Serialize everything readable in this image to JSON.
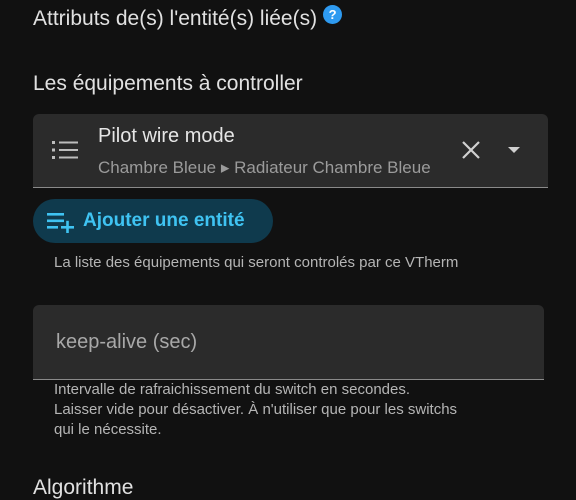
{
  "attributes": {
    "title": "Attributs de(s) l'entité(s) liée(s)",
    "help_icon": "help-circle-icon",
    "help_glyph": "?"
  },
  "equipments": {
    "title": "Les équipements à controller",
    "entity": {
      "icon": "list-icon",
      "name": "Pilot wire mode",
      "path": "Chambre Bleue ▸ Radiateur Chambre Bleue"
    },
    "add_button": {
      "icon": "playlist-plus-icon",
      "label": "Ajouter une entité"
    },
    "helper": "La liste des équipements qui seront controlés par ce VTherm"
  },
  "keep_alive": {
    "placeholder": "keep-alive (sec)",
    "value": "",
    "helper_lines": [
      "Intervalle de rafraichissement du switch en secondes.",
      "Laisser vide pour désactiver. À n'utiliser que pour les switchs",
      "qui le nécessite."
    ]
  },
  "algorithm": {
    "title": "Algorithme"
  },
  "colors": {
    "background": "#111111",
    "accent": "#3fc3f2",
    "help_badge": "#2e9af0"
  }
}
